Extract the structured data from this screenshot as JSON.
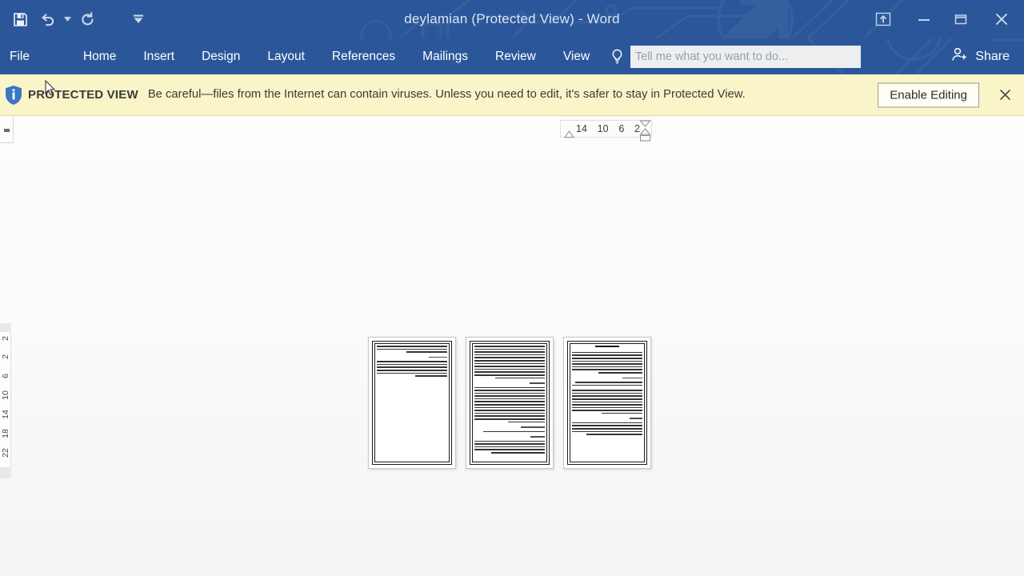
{
  "window": {
    "title": "deylamian (Protected View) - Word",
    "accent_color": "#2b579a",
    "controls": [
      {
        "name": "ribbon-display-options",
        "label": "Ribbon Display Options"
      },
      {
        "name": "minimize",
        "label": "Minimize"
      },
      {
        "name": "maximize",
        "label": "Restore Down"
      },
      {
        "name": "close",
        "label": "Close"
      }
    ]
  },
  "quick_access": {
    "items": [
      {
        "icon": "save-icon",
        "label": "Save"
      },
      {
        "icon": "undo-icon",
        "label": "Undo"
      },
      {
        "icon": "undo-dropdown-icon",
        "label": "Undo options"
      },
      {
        "icon": "redo-icon",
        "label": "Repeat"
      },
      {
        "icon": "customize-qat-icon",
        "label": "Customize Quick Access Toolbar"
      }
    ]
  },
  "ribbon": {
    "tabs": [
      {
        "label": "File"
      },
      {
        "label": "Home"
      },
      {
        "label": "Insert"
      },
      {
        "label": "Design"
      },
      {
        "label": "Layout"
      },
      {
        "label": "References"
      },
      {
        "label": "Mailings"
      },
      {
        "label": "Review"
      },
      {
        "label": "View"
      }
    ],
    "tell_me": {
      "placeholder": "Tell me what you want to do...",
      "value": "",
      "icon": "lightbulb-icon"
    },
    "share": {
      "label": "Share",
      "icon": "share-person-icon"
    }
  },
  "protected_view": {
    "icon": "shield-info-icon",
    "label": "PROTECTED VIEW",
    "message": "Be careful—files from the Internet can contain viruses. Unless you need to edit, it's safer to stay in Protected View.",
    "enable_button": "Enable Editing",
    "close_label": "×",
    "background_color": "#faf5c8"
  },
  "rulers": {
    "horizontal": {
      "ticks": [
        "14",
        "10",
        "6",
        "2"
      ]
    },
    "vertical": {
      "ticks": [
        "2",
        "2",
        "6",
        "10",
        "14",
        "18",
        "22"
      ]
    },
    "tab_selector": {
      "label": "Left Tab"
    }
  },
  "document": {
    "zoom_view": "multiple-pages",
    "pages": [
      {
        "number": 1,
        "has_title": false,
        "paragraphs": [
          3,
          6
        ]
      },
      {
        "number": 2,
        "has_title": false,
        "paragraphs": [
          12,
          13,
          1,
          5
        ]
      },
      {
        "number": 3,
        "has_title": true,
        "paragraphs": [
          8,
          2,
          9,
          5
        ]
      }
    ]
  }
}
